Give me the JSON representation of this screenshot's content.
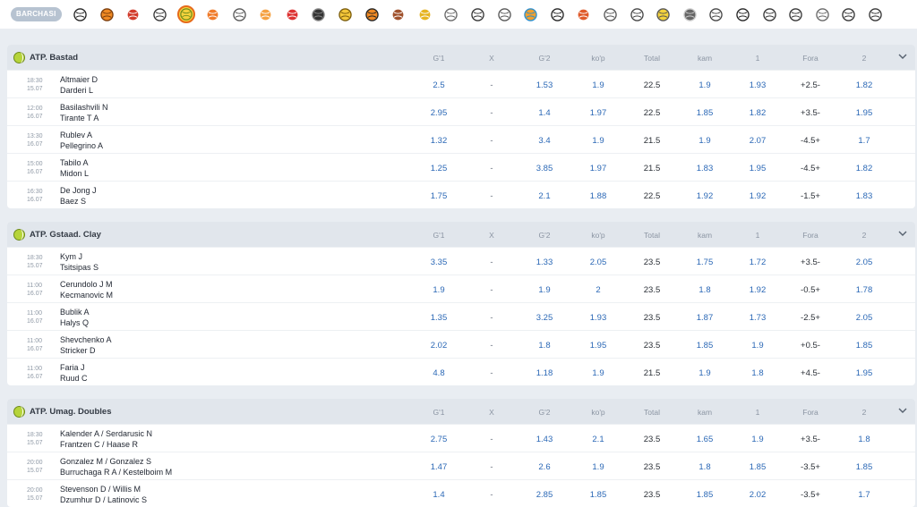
{
  "all_label": "BARCHASI",
  "sports": [
    "football",
    "basketball",
    "dota",
    "boxing",
    "tennis",
    "amfootball",
    "volleyball",
    "badminton",
    "gloves",
    "hockey",
    "handball",
    "basketball2",
    "rugby",
    "cricket",
    "shuttlecock",
    "baseball",
    "ball",
    "beach",
    "racing",
    "mma",
    "rugby2",
    "snooker",
    "volley2",
    "bowling",
    "goal",
    "hockey2",
    "racket",
    "tabletennis",
    "ball2",
    "athletics",
    "horse"
  ],
  "columns": [
    "G'1",
    "X",
    "G'2",
    "ko'p",
    "Total",
    "kam",
    "1",
    "Fora",
    "2"
  ],
  "leagues": [
    {
      "name": "ATP. Bastad",
      "matches": [
        {
          "time": "18:30",
          "date": "15.07",
          "team1": "Altmaier D",
          "team2": "Darderi L",
          "g1": "2.5",
          "x": "-",
          "g2": "1.53",
          "kop": "1.9",
          "total": "22.5",
          "kam": "1.9",
          "one": "1.93",
          "fora": "+2.5-",
          "two": "1.82"
        },
        {
          "time": "12:00",
          "date": "16.07",
          "team1": "Basilashvili N",
          "team2": "Tirante T A",
          "g1": "2.95",
          "x": "-",
          "g2": "1.4",
          "kop": "1.97",
          "total": "22.5",
          "kam": "1.85",
          "one": "1.82",
          "fora": "+3.5-",
          "two": "1.95"
        },
        {
          "time": "13:30",
          "date": "16.07",
          "team1": "Rublev A",
          "team2": "Pellegrino A",
          "g1": "1.32",
          "x": "-",
          "g2": "3.4",
          "kop": "1.9",
          "total": "21.5",
          "kam": "1.9",
          "one": "2.07",
          "fora": "-4.5+",
          "two": "1.7"
        },
        {
          "time": "15:00",
          "date": "16.07",
          "team1": "Tabilo A",
          "team2": "Midon L",
          "g1": "1.25",
          "x": "-",
          "g2": "3.85",
          "kop": "1.97",
          "total": "21.5",
          "kam": "1.83",
          "one": "1.95",
          "fora": "-4.5+",
          "two": "1.82"
        },
        {
          "time": "16:30",
          "date": "16.07",
          "team1": "De Jong J",
          "team2": "Baez S",
          "g1": "1.75",
          "x": "-",
          "g2": "2.1",
          "kop": "1.88",
          "total": "22.5",
          "kam": "1.92",
          "one": "1.92",
          "fora": "-1.5+",
          "two": "1.83"
        }
      ]
    },
    {
      "name": "ATP. Gstaad. Clay",
      "matches": [
        {
          "time": "18:30",
          "date": "15.07",
          "team1": "Kym J",
          "team2": "Tsitsipas S",
          "g1": "3.35",
          "x": "-",
          "g2": "1.33",
          "kop": "2.05",
          "total": "23.5",
          "kam": "1.75",
          "one": "1.72",
          "fora": "+3.5-",
          "two": "2.05"
        },
        {
          "time": "11:00",
          "date": "16.07",
          "team1": "Cerundolo J M",
          "team2": "Kecmanovic M",
          "g1": "1.9",
          "x": "-",
          "g2": "1.9",
          "kop": "2",
          "total": "23.5",
          "kam": "1.8",
          "one": "1.92",
          "fora": "-0.5+",
          "two": "1.78"
        },
        {
          "time": "11:00",
          "date": "16.07",
          "team1": "Bublik A",
          "team2": "Halys Q",
          "g1": "1.35",
          "x": "-",
          "g2": "3.25",
          "kop": "1.93",
          "total": "23.5",
          "kam": "1.87",
          "one": "1.73",
          "fora": "-2.5+",
          "two": "2.05"
        },
        {
          "time": "11:00",
          "date": "16.07",
          "team1": "Shevchenko A",
          "team2": "Stricker D",
          "g1": "2.02",
          "x": "-",
          "g2": "1.8",
          "kop": "1.95",
          "total": "23.5",
          "kam": "1.85",
          "one": "1.9",
          "fora": "+0.5-",
          "two": "1.85"
        },
        {
          "time": "11:00",
          "date": "16.07",
          "team1": "Faria J",
          "team2": "Ruud C",
          "g1": "4.8",
          "x": "-",
          "g2": "1.18",
          "kop": "1.9",
          "total": "21.5",
          "kam": "1.9",
          "one": "1.8",
          "fora": "+4.5-",
          "two": "1.95"
        }
      ]
    },
    {
      "name": "ATP. Umag. Doubles",
      "matches": [
        {
          "time": "18:30",
          "date": "15.07",
          "team1": "Kalender A / Serdarusic N",
          "team2": "Frantzen C / Haase R",
          "g1": "2.75",
          "x": "-",
          "g2": "1.43",
          "kop": "2.1",
          "total": "23.5",
          "kam": "1.65",
          "one": "1.9",
          "fora": "+3.5-",
          "two": "1.8"
        },
        {
          "time": "20:00",
          "date": "15.07",
          "team1": "Gonzalez M / Gonzalez S",
          "team2": "Burruchaga R A / Kestelboim M",
          "g1": "1.47",
          "x": "-",
          "g2": "2.6",
          "kop": "1.9",
          "total": "23.5",
          "kam": "1.8",
          "one": "1.85",
          "fora": "-3.5+",
          "two": "1.85"
        },
        {
          "time": "20:00",
          "date": "15.07",
          "team1": "Stevenson D / Willis M",
          "team2": "Dzumhur D / Latinovic S",
          "g1": "1.4",
          "x": "-",
          "g2": "2.85",
          "kop": "1.85",
          "total": "23.5",
          "kam": "1.85",
          "one": "2.02",
          "fora": "-3.5+",
          "two": "1.7"
        }
      ]
    }
  ]
}
